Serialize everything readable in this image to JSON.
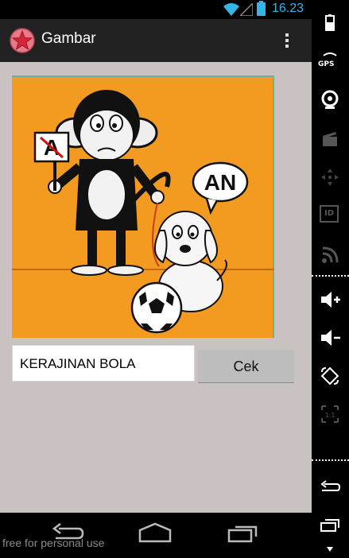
{
  "status_bar": {
    "time": "16.23",
    "wifi_icon": "wifi-icon",
    "signal_icon": "signal-icon",
    "battery_icon": "battery-icon"
  },
  "action_bar": {
    "title": "Gambar",
    "app_icon": "star-app-icon",
    "menu_icon": "overflow-menu-icon"
  },
  "puzzle": {
    "picture_icon": "monkey-dog-ball-illustration",
    "sign_letter": "A",
    "bubble_text": "AN"
  },
  "answer": {
    "value": "KERAJINAN BOLA"
  },
  "check_button": {
    "label": "Cek"
  },
  "nav_bar": {
    "back_icon": "back-icon",
    "home_icon": "home-icon",
    "recents_icon": "recents-icon",
    "watermark": "free for personal use"
  },
  "side_panel": {
    "gps_label": "GPS",
    "id_label": "ID",
    "volume_up_label": "+",
    "volume_down_label": "-",
    "scale_label": "1:1"
  },
  "colors": {
    "accent": "#33b5e5",
    "background": "#cac1c1",
    "picture_bg": "#f39a20"
  }
}
